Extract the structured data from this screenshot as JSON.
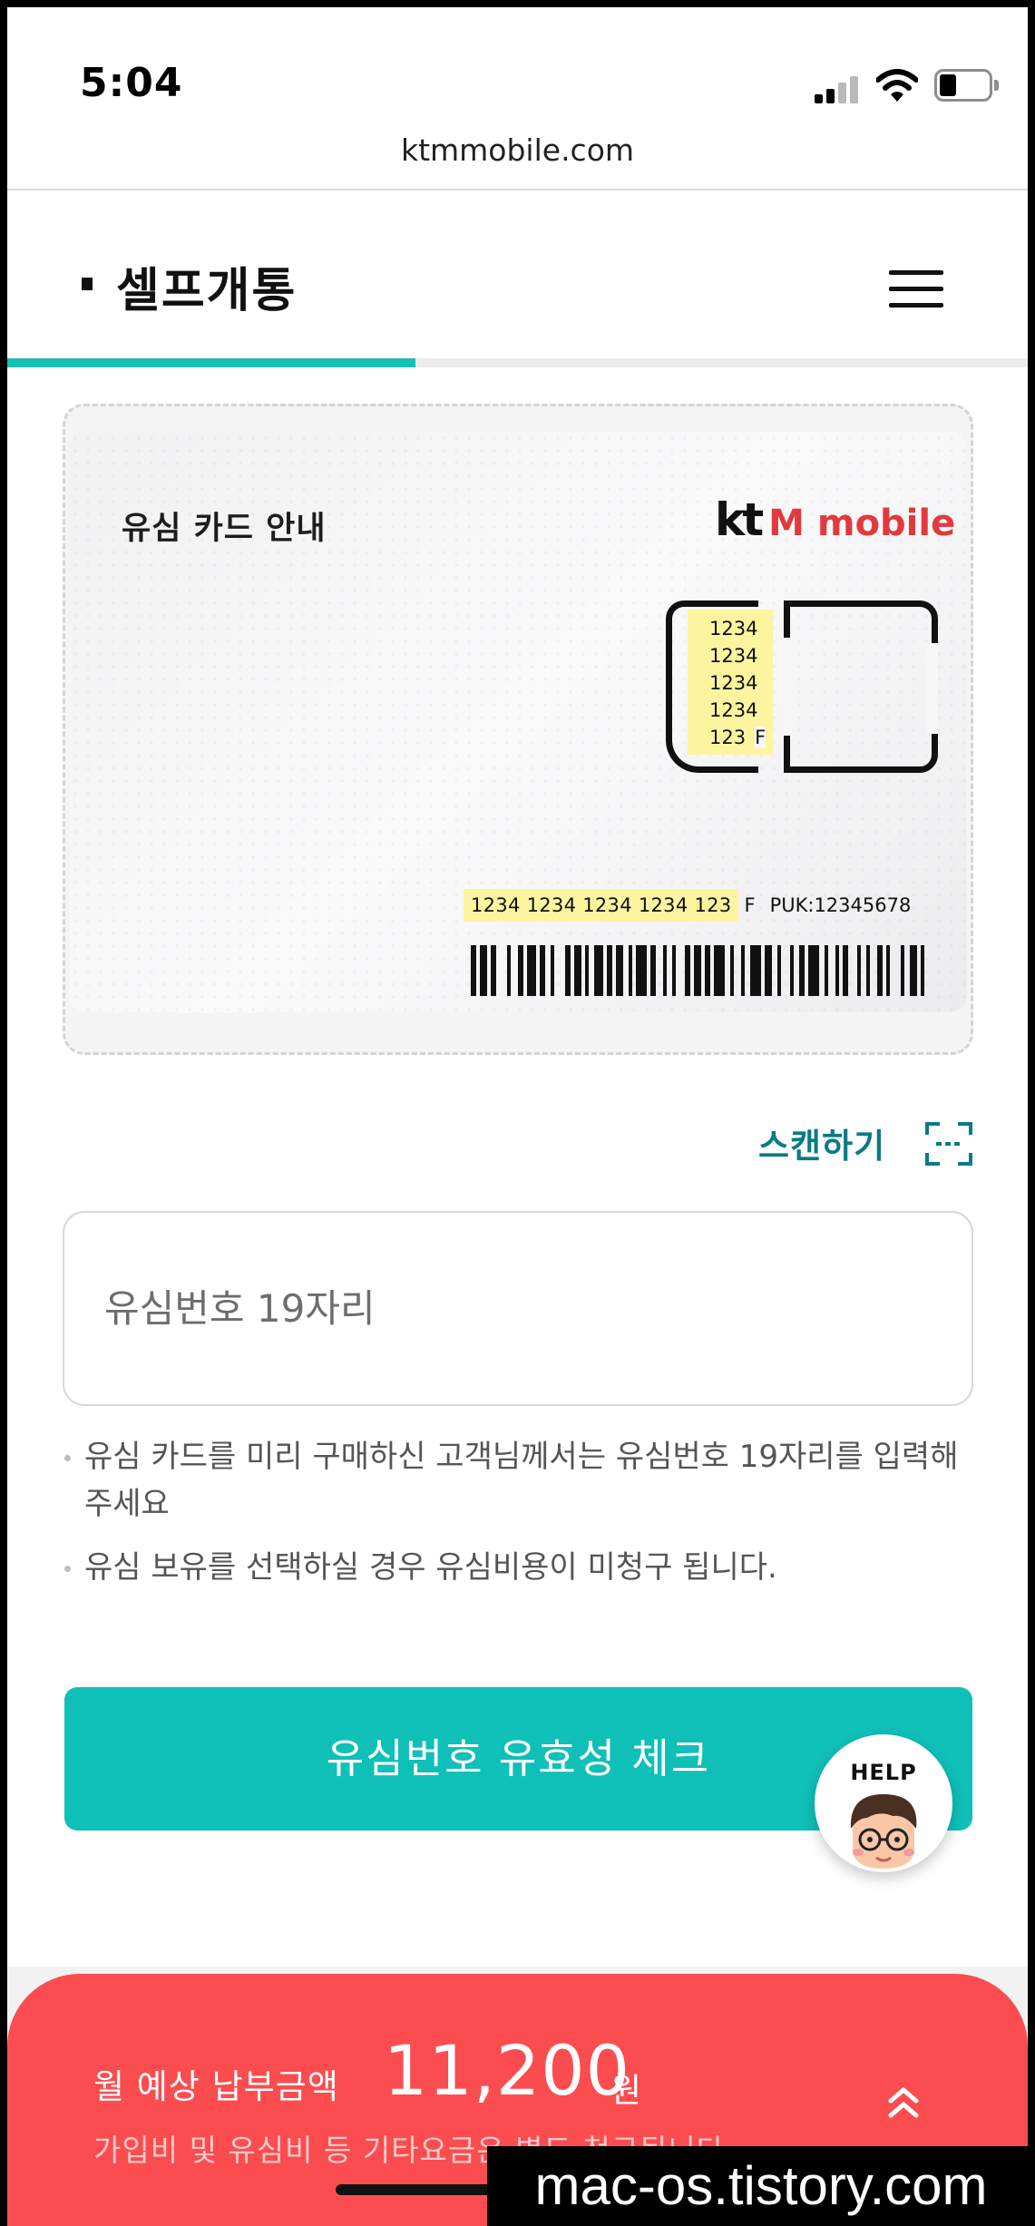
{
  "status_bar": {
    "time": "5:04"
  },
  "browser": {
    "url": "ktmmobile.com"
  },
  "header": {
    "title": "셀프개통",
    "progress": 0.4
  },
  "sim_card": {
    "title": "유심 카드 안내",
    "logo_kt": "kt",
    "logo_mm": "M mobile",
    "chip_numbers": [
      "1234",
      "1234",
      "1234",
      "1234",
      "123"
    ],
    "chip_suffix": "F",
    "serial": "1234 1234 1234 1234 123",
    "serial_suffix": "F",
    "puk": "PUK:12345678"
  },
  "scan": {
    "label": "스캔하기",
    "icon": "scan-icon"
  },
  "sim_input": {
    "placeholder": "유심번호 19자리",
    "value": ""
  },
  "notes": [
    "유심 카드를 미리 구매하신 고객님께서는 유심번호 19자리를 입력해 주세요",
    "유심 보유를 선택하실 경우 유심비용이 미청구 됩니다."
  ],
  "check_button": {
    "label": "유심번호 유효성 체크"
  },
  "help": {
    "label": "HELP"
  },
  "bottom_sheet": {
    "label": "월 예상 납부금액",
    "amount": "11,200",
    "unit": "원",
    "note": "가입비 및 유심비 등 기타요금은 별도 청구됩니다"
  },
  "watermark": "mac-os.tistory.com",
  "colors": {
    "accent": "#0fc0b9",
    "scan": "#0b7b84",
    "sheet": "#fb4d4f",
    "logo_red": "#e03a3f"
  }
}
